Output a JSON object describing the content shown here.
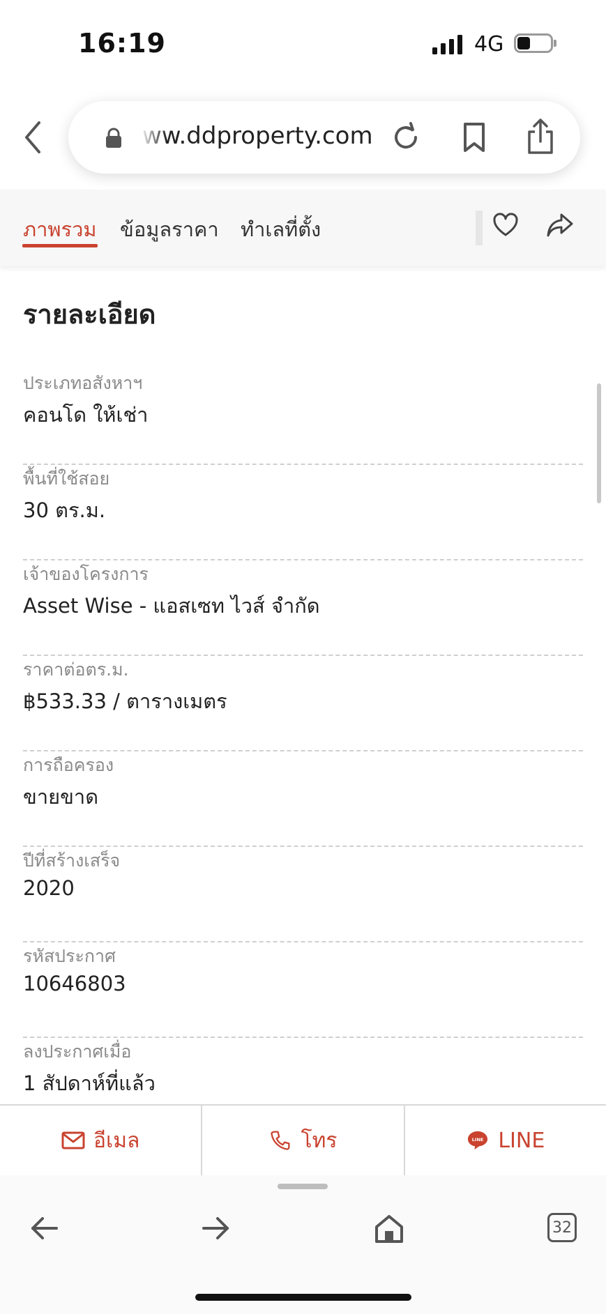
{
  "status_bar": {
    "time": "16:19",
    "network": "4G"
  },
  "browser": {
    "url": "ww.ddproperty.com",
    "tabs_count": "32"
  },
  "tabs": [
    {
      "label": "ภาพรวม",
      "active": true
    },
    {
      "label": "ข้อมูลราคา",
      "active": false
    },
    {
      "label": "ทำเลที่ตั้ง",
      "active": false
    }
  ],
  "section_title": "รายละเอียด",
  "details": [
    {
      "label": "ประเภทอสังหาฯ",
      "value": "คอนโด ให้เช่า"
    },
    {
      "label": "พื้นที่ใช้สอย",
      "value": "30 ตร.ม."
    },
    {
      "label": "เจ้าของโครงการ",
      "value": "Asset Wise - แอสเซท ไวส์ จำกัด"
    },
    {
      "label": "ราคาต่อตร.ม.",
      "value": "฿533.33 / ตารางเมตร"
    },
    {
      "label": "การถือครอง",
      "value": "ขายขาด"
    },
    {
      "label": "ปีที่สร้างเสร็จ",
      "value": "2020"
    },
    {
      "label": "รหัสประกาศ",
      "value": "10646803"
    },
    {
      "label": "ลงประกาศเมื่อ",
      "value": "1 สัปดาห์ที่แล้ว"
    }
  ],
  "contact": {
    "email": "อีเมล",
    "phone": "โทร",
    "line": "LINE"
  },
  "colors": {
    "accent": "#c9432f"
  }
}
